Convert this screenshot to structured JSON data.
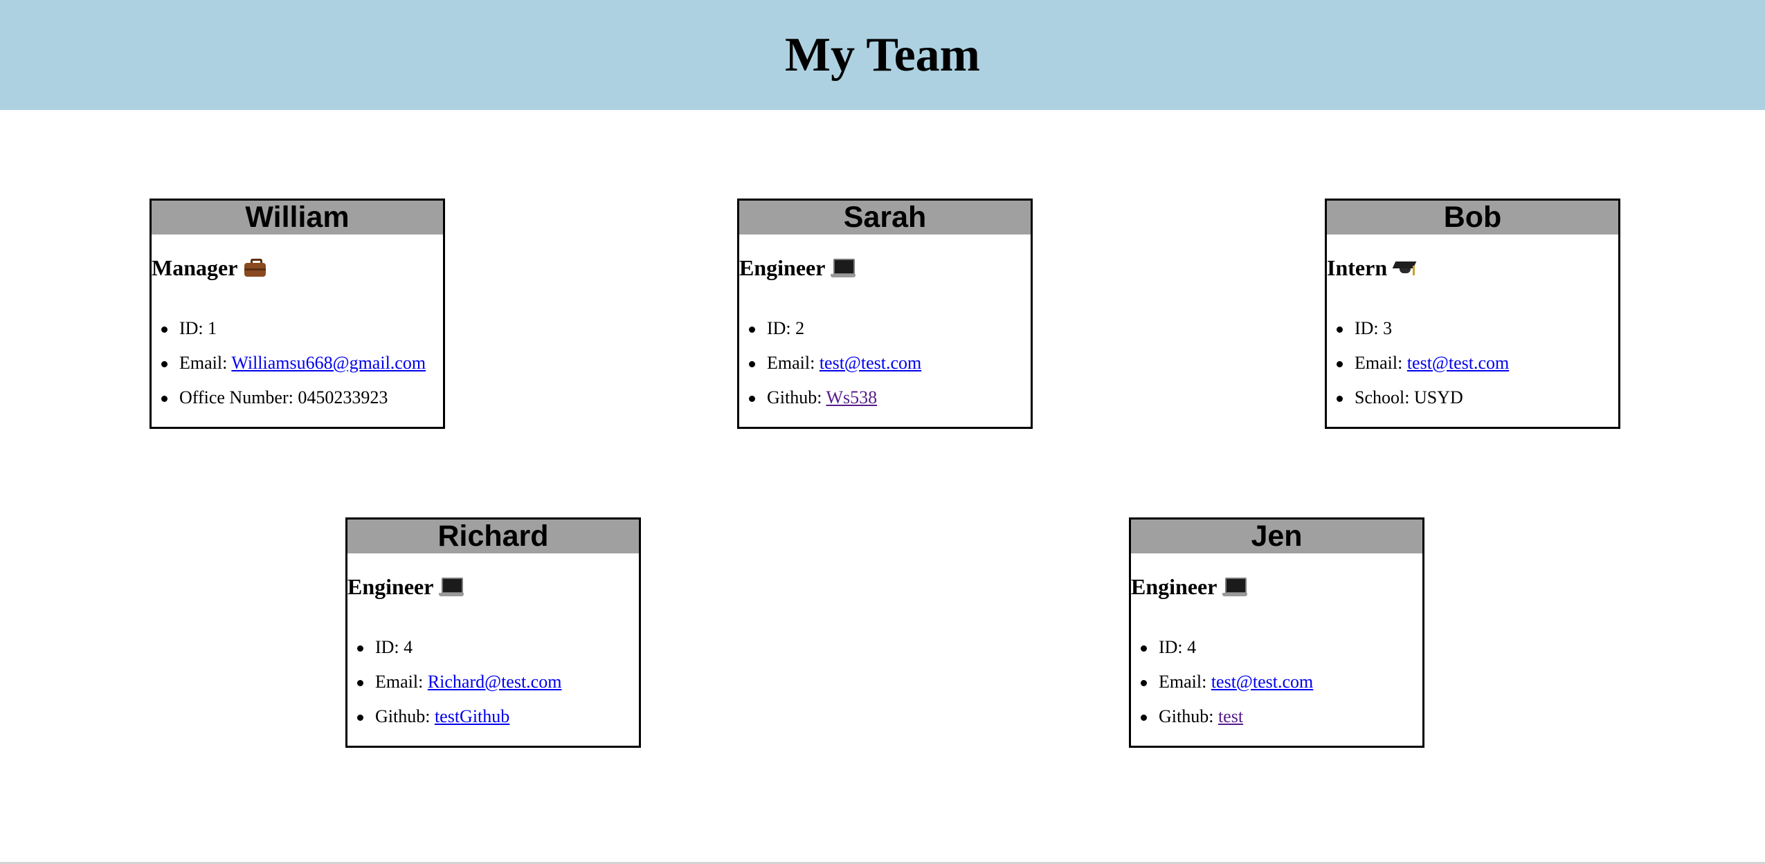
{
  "header": {
    "title": "My Team"
  },
  "team": [
    {
      "name": "William",
      "role": "Manager",
      "role_icon": "briefcase-icon",
      "items": [
        {
          "label": "ID: ",
          "value": "1",
          "is_link": false
        },
        {
          "label": "Email: ",
          "value": "Williamsu668@gmail.com",
          "is_link": true,
          "visited": false
        },
        {
          "label": "Office Number: ",
          "value": "0450233923",
          "is_link": false
        }
      ]
    },
    {
      "name": "Sarah",
      "role": "Engineer",
      "role_icon": "laptop-icon",
      "items": [
        {
          "label": "ID: ",
          "value": "2",
          "is_link": false
        },
        {
          "label": "Email: ",
          "value": "test@test.com",
          "is_link": true,
          "visited": false
        },
        {
          "label": "Github: ",
          "value": "Ws538",
          "is_link": true,
          "visited": true
        }
      ]
    },
    {
      "name": "Bob",
      "role": "Intern",
      "role_icon": "graduation-cap-icon",
      "items": [
        {
          "label": "ID: ",
          "value": "3",
          "is_link": false
        },
        {
          "label": "Email: ",
          "value": "test@test.com",
          "is_link": true,
          "visited": false
        },
        {
          "label": "School: ",
          "value": "USYD",
          "is_link": false
        }
      ]
    },
    {
      "name": "Richard",
      "role": "Engineer",
      "role_icon": "laptop-icon",
      "items": [
        {
          "label": "ID: ",
          "value": "4",
          "is_link": false
        },
        {
          "label": "Email: ",
          "value": "Richard@test.com",
          "is_link": true,
          "visited": false
        },
        {
          "label": "Github: ",
          "value": "testGithub",
          "is_link": true,
          "visited": false
        }
      ]
    },
    {
      "name": "Jen",
      "role": "Engineer",
      "role_icon": "laptop-icon",
      "items": [
        {
          "label": "ID: ",
          "value": "4",
          "is_link": false
        },
        {
          "label": "Email: ",
          "value": "test@test.com",
          "is_link": true,
          "visited": false
        },
        {
          "label": "Github: ",
          "value": "test",
          "is_link": true,
          "visited": true
        }
      ]
    }
  ],
  "colors": {
    "header_background": "#add1e0",
    "card_header_background": "#a0a0a0",
    "link": "#0000ee",
    "visited_link": "#551a8b"
  }
}
